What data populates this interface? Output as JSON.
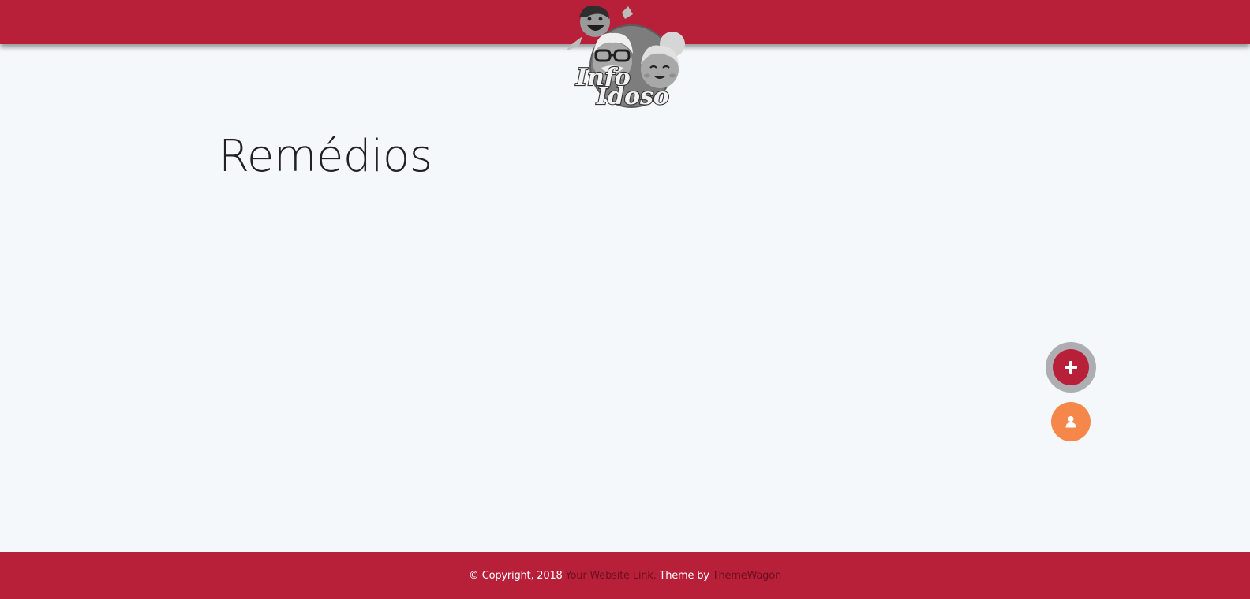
{
  "colors": {
    "brand": "#b8203a",
    "background": "#f5f8fa",
    "fab_ring": "#aeaeb2",
    "fab_user": "#f5874a",
    "footer_link": "#6b0f1f"
  },
  "header": {
    "logo": {
      "line1": "Info",
      "line2": "Idoso",
      "icon": "info-idoso-logo-icon"
    }
  },
  "main": {
    "title": "Remédios"
  },
  "fab": {
    "add_icon": "plus-icon",
    "user_icon": "user-icon"
  },
  "footer": {
    "copyright": "© Copyright, 2018",
    "website_link": "Your Website Link.",
    "theme_by": "Theme by",
    "themewagon_link": "ThemeWagon"
  }
}
